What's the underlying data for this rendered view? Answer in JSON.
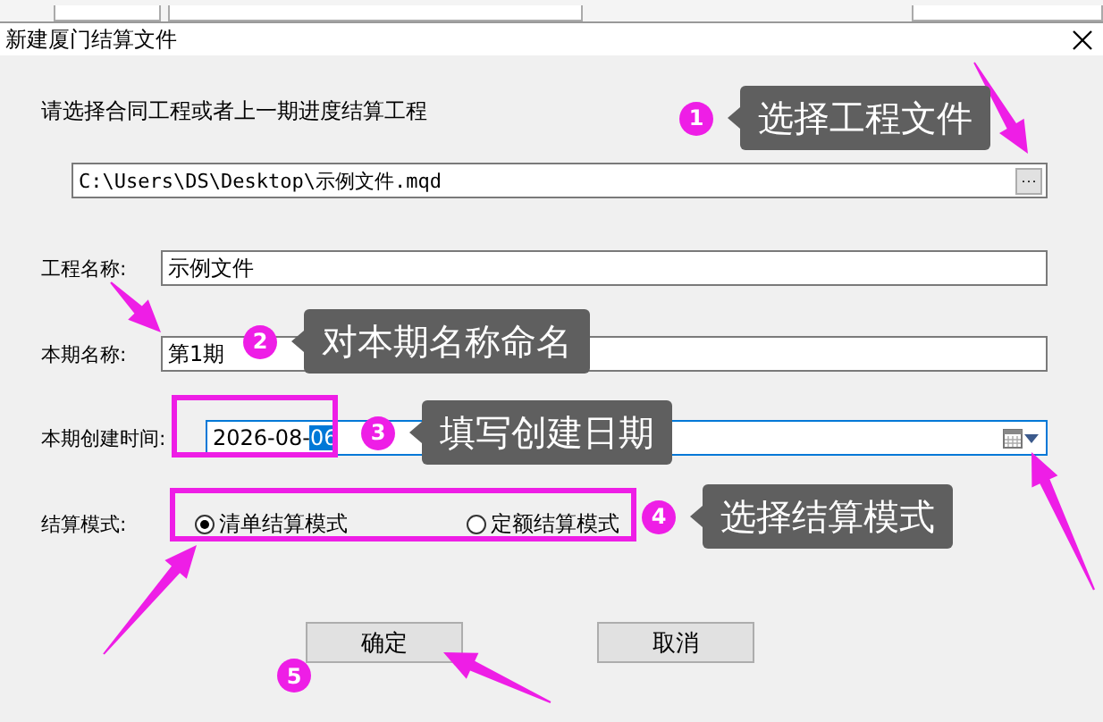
{
  "window": {
    "title": "新建厦门结算文件"
  },
  "file_prompt": "请选择合同工程或者上一期进度结算工程",
  "path_field": {
    "value": "C:\\Users\\DS\\Desktop\\示例文件.mqd",
    "browse": "···"
  },
  "fields": [
    {
      "label": "工程名称:",
      "value": "示例文件"
    },
    {
      "label": "本期名称:",
      "value": "第1期"
    }
  ],
  "date_field": {
    "label": "本期创建时间:",
    "value": "2026-08-",
    "selected_text": "06"
  },
  "mode": {
    "label": "结算模式:",
    "options": [
      {
        "label": "清单结算模式",
        "selected": true
      },
      {
        "label": "定额结算模式",
        "selected": false
      }
    ]
  },
  "buttons": [
    {
      "label": "确定"
    },
    {
      "label": "取消"
    }
  ],
  "annotations": [
    {
      "number": "1",
      "text": "选择工程文件"
    },
    {
      "number": "2",
      "text": "对本期名称命名"
    },
    {
      "number": "3",
      "text": "填写创建日期"
    },
    {
      "number": "4",
      "text": "选择结算模式"
    },
    {
      "number": "5"
    }
  ]
}
